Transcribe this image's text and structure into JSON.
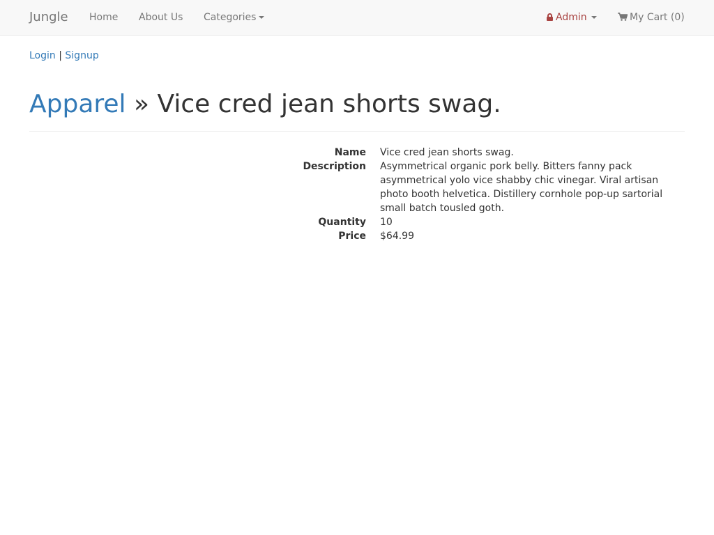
{
  "navbar": {
    "brand": "Jungle",
    "home": "Home",
    "about": "About Us",
    "categories": "Categories",
    "admin": "Admin",
    "cart": "My Cart (0)",
    "admin_color": "#a94442"
  },
  "auth": {
    "login": "Login",
    "separator": "|",
    "signup": "Signup"
  },
  "header": {
    "category": "Apparel",
    "separator": "»",
    "product_name": "Vice cred jean shorts swag."
  },
  "product": {
    "name_label": "Name",
    "name_value": "Vice cred jean shorts swag.",
    "description_label": "Description",
    "description_value": "Asymmetrical organic pork belly. Bitters fanny pack asymmetrical yolo vice shabby chic vinegar. Viral artisan photo booth helvetica. Distillery cornhole pop-up sartorial small batch tousled goth.",
    "quantity_label": "Quantity",
    "quantity_value": "10",
    "price_label": "Price",
    "price_value": "$64.99"
  },
  "icons": {
    "admin": "lock-icon",
    "cart": "shopping-cart-icon",
    "dropdown": "caret-down-icon"
  }
}
